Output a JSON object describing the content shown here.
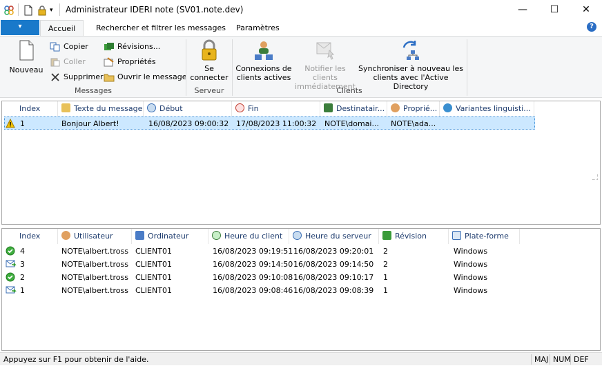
{
  "window": {
    "title": "Administrateur IDERI note (SV01.note.dev)",
    "minimize": "—",
    "maximize": "☐",
    "close": "✕"
  },
  "ribbon": {
    "file_tab": "▾",
    "tabs": [
      "Accueil",
      "Rechercher et filtrer les messages",
      "Paramètres"
    ],
    "active_tab": "Accueil",
    "help": "?",
    "groups": {
      "messages": {
        "label": "Messages",
        "nouveau": "Nouveau",
        "copier": "Copier",
        "coller": "Coller",
        "supprimer": "Supprimer",
        "revisions": "Révisions...",
        "proprietes": "Propriétés",
        "ouvrir": "Ouvrir le message"
      },
      "serveur": {
        "label": "Serveur",
        "connect_line1": "Se",
        "connect_line2": "connecter"
      },
      "clients": {
        "label": "Clients",
        "connexions_line1": "Connexions de",
        "connexions_line2": "clients actives",
        "notifier_line1": "Notifier les clients",
        "notifier_line2": "immédiatement",
        "sync_line1": "Synchroniser à nouveau les",
        "sync_line2": "clients avec l'Active Directory"
      }
    }
  },
  "messages_list": {
    "columns": [
      "Index",
      "Texte du message",
      "Début",
      "Fin",
      "Destinatair...",
      "Proprié...",
      "Variantes linguisti..."
    ],
    "rows": [
      {
        "index": "1",
        "text": "Bonjour Albert!",
        "start": "16/08/2023 09:00:32",
        "end": "17/08/2023 11:00:32",
        "recipients": "NOTE\\domai...",
        "owner": "NOTE\\ada..."
      }
    ]
  },
  "receipts_list": {
    "columns": [
      "Index",
      "Utilisateur",
      "Ordinateur",
      "Heure du client",
      "Heure du serveur",
      "Révision",
      "Plate-forme"
    ],
    "rows": [
      {
        "status": "confirmed",
        "index": "4",
        "user": "NOTE\\albert.tross",
        "computer": "CLIENT01",
        "client_time": "16/08/2023 09:19:51",
        "server_time": "16/08/2023 09:20:01",
        "revision": "2",
        "platform": "Windows"
      },
      {
        "status": "received",
        "index": "3",
        "user": "NOTE\\albert.tross",
        "computer": "CLIENT01",
        "client_time": "16/08/2023 09:14:50",
        "server_time": "16/08/2023 09:14:50",
        "revision": "2",
        "platform": "Windows"
      },
      {
        "status": "confirmed",
        "index": "2",
        "user": "NOTE\\albert.tross",
        "computer": "CLIENT01",
        "client_time": "16/08/2023 09:10:08",
        "server_time": "16/08/2023 09:10:17",
        "revision": "1",
        "platform": "Windows"
      },
      {
        "status": "received",
        "index": "1",
        "user": "NOTE\\albert.tross",
        "computer": "CLIENT01",
        "client_time": "16/08/2023 09:08:46",
        "server_time": "16/08/2023 09:08:39",
        "revision": "1",
        "platform": "Windows"
      }
    ]
  },
  "statusbar": {
    "text": "Appuyez sur F1 pour obtenir de l'aide.",
    "caps": "MAJ",
    "num": "NUM",
    "scroll": "DEF"
  }
}
